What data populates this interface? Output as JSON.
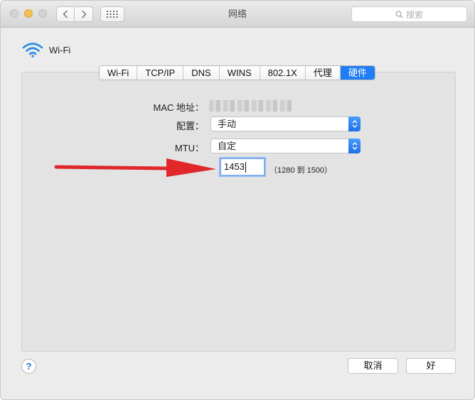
{
  "window": {
    "title": "网络"
  },
  "search": {
    "placeholder": "搜索"
  },
  "interface": {
    "name": "Wi-Fi"
  },
  "tabs": [
    {
      "label": "Wi-Fi",
      "active": false
    },
    {
      "label": "TCP/IP",
      "active": false
    },
    {
      "label": "DNS",
      "active": false
    },
    {
      "label": "WINS",
      "active": false
    },
    {
      "label": "802.1X",
      "active": false
    },
    {
      "label": "代理",
      "active": false
    },
    {
      "label": "硬件",
      "active": true
    }
  ],
  "hardware": {
    "mac_label": "MAC 地址：",
    "config_label": "配置：",
    "config_value": "手动",
    "mtu_label": "MTU：",
    "mtu_mode_value": "自定",
    "mtu_value": "1453",
    "mtu_range": "（1280 到 1500）"
  },
  "buttons": {
    "help": "?",
    "cancel": "取消",
    "ok": "好"
  },
  "colors": {
    "accent": "#1f7df5",
    "annotation_arrow": "#e0282a"
  }
}
